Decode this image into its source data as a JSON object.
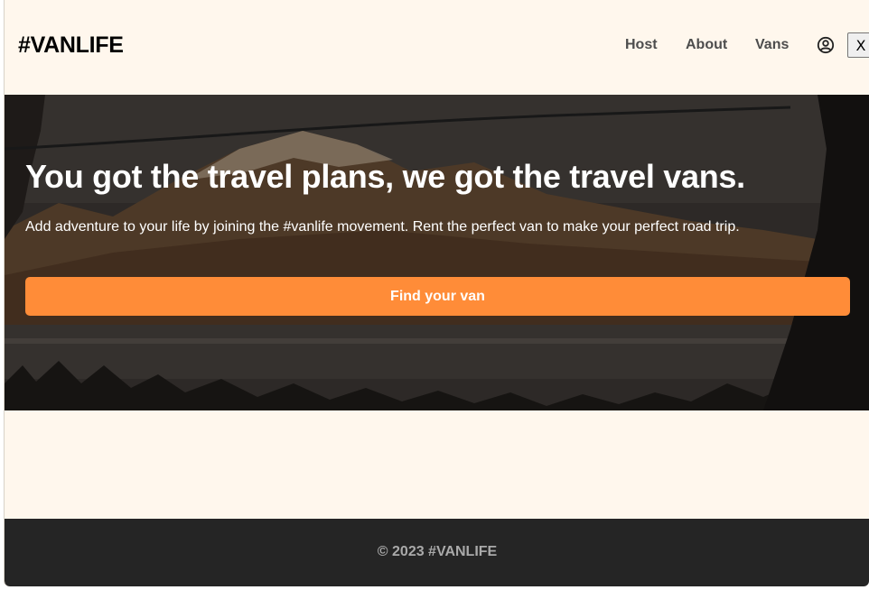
{
  "header": {
    "logo": "#VANLIFE",
    "nav": [
      {
        "label": "Host"
      },
      {
        "label": "About"
      },
      {
        "label": "Vans"
      }
    ],
    "user_icon": "user-circle-icon",
    "logout_label": "X"
  },
  "hero": {
    "title": "You got the travel plans, we got the travel vans.",
    "subtitle": "Add adventure to your life by joining the #vanlife movement. Rent the perfect van to make your perfect road trip.",
    "cta_label": "Find your van",
    "colors": {
      "cta": "#FF8C38"
    }
  },
  "footer": {
    "text": "© 2023 #VANLIFE"
  },
  "colors": {
    "background": "#FFF7ED",
    "footer": "#252525",
    "accent": "#FF8C38"
  }
}
